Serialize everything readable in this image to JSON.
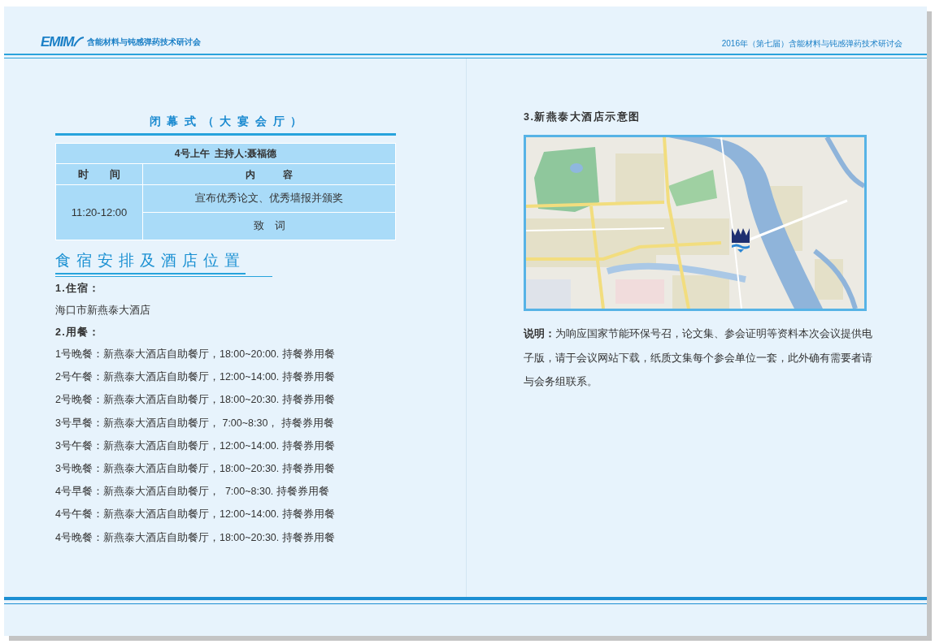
{
  "header": {
    "logo": {
      "mark": "EMIM",
      "name": "含能材料与钝感弹药技术研讨会"
    },
    "title": "2016年（第七届）含能材料与钝感弹药技术研讨会"
  },
  "closing_ceremony": {
    "title": "闭幕式（大宴会厅）",
    "table": {
      "caption": "4号上午  主持人:聂福德",
      "columns": [
        "时间",
        "内容"
      ],
      "rows": [
        {
          "time": "11:20-12:00",
          "items": [
            "宣布优秀论文、优秀墙报并颁奖",
            "致　词"
          ]
        }
      ]
    }
  },
  "accommodation": {
    "title": "食宿安排及酒店位置",
    "lodging": {
      "heading": "1.住宿：",
      "hotel": "海口市新燕泰大酒店"
    },
    "meals": {
      "heading": "2.用餐：",
      "items": [
        "1号晚餐：新燕泰大酒店自助餐厅，18:00~20:00. 持餐券用餐",
        "2号午餐：新燕泰大酒店自助餐厅，12:00~14:00. 持餐券用餐",
        "2号晚餐：新燕泰大酒店自助餐厅，18:00~20:30. 持餐券用餐",
        "3号早餐：新燕泰大酒店自助餐厅， 7:00~8:30， 持餐券用餐",
        "3号午餐：新燕泰大酒店自助餐厅，12:00~14:00. 持餐券用餐",
        "3号晚餐：新燕泰大酒店自助餐厅，18:00~20:30. 持餐券用餐",
        "4号早餐：新燕泰大酒店自助餐厅，  7:00~8:30. 持餐券用餐",
        "4号午餐：新燕泰大酒店自助餐厅，12:00~14:00. 持餐券用餐",
        "4号晚餐：新燕泰大酒店自助餐厅，18:00~20:30. 持餐券用餐"
      ]
    }
  },
  "hotel_map": {
    "heading": "3.新燕泰大酒店示意图"
  },
  "note": "**说明：**为响应国家节能环保号召，论文集、参会证明等资料本次会议提供电子版，请于会议网站下载，纸质文集每个参会单位一套，此外确有需要者请与会务组联系。"
}
